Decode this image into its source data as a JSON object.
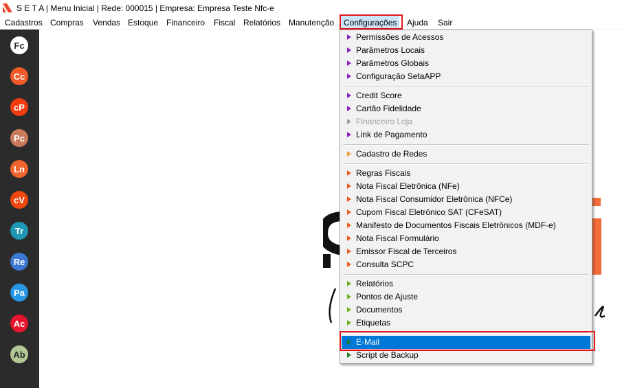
{
  "window": {
    "title": "S E T A | Menu Inicial | Rede: 000015 | Empresa: Empresa Teste Nfc-e"
  },
  "menubar": {
    "items": [
      {
        "label": "Cadastros"
      },
      {
        "label": "Compras"
      },
      {
        "label": "Vendas"
      },
      {
        "label": "Estoque"
      },
      {
        "label": "Financeiro"
      },
      {
        "label": "Fiscal"
      },
      {
        "label": "Relatórios"
      },
      {
        "label": "Manutenção"
      },
      {
        "label": "Configurações"
      },
      {
        "label": "Ajuda"
      },
      {
        "label": "Sair"
      }
    ],
    "active_index": 8
  },
  "sidebar": {
    "buttons": [
      {
        "label": "Fc",
        "color": "#ffffff",
        "text_color": "#2b2b2b"
      },
      {
        "label": "Cc",
        "color": "#f05a28"
      },
      {
        "label": "cP",
        "color": "#f03c0f"
      },
      {
        "label": "Pc",
        "color": "#c87a5a"
      },
      {
        "label": "Ln",
        "color": "#f0642d"
      },
      {
        "label": "cV",
        "color": "#f0460f"
      },
      {
        "label": "Tr",
        "color": "#1e96b4"
      },
      {
        "label": "Re",
        "color": "#3c78d2"
      },
      {
        "label": "Pa",
        "color": "#2896e6"
      },
      {
        "label": "Ac",
        "color": "#e6142d"
      },
      {
        "label": "Ab",
        "color": "#b4c896",
        "text_color": "#2b2b2b"
      }
    ]
  },
  "dropdown": {
    "groups": [
      {
        "arrow_color": "#8b21c4",
        "items": [
          {
            "label": "Permissões de Acessos"
          },
          {
            "label": "Parâmetros Locais"
          },
          {
            "label": "Parâmetros Globais"
          },
          {
            "label": "Configuração SetaAPP"
          }
        ]
      },
      {
        "arrow_color": "#8b21c4",
        "items": [
          {
            "label": "Credit Score"
          },
          {
            "label": "Cartão Fidelidade"
          },
          {
            "label": "Financeiro Loja",
            "disabled": true
          },
          {
            "label": "Link de Pagamento"
          }
        ]
      },
      {
        "arrow_color": "#f0a030",
        "items": [
          {
            "label": "Cadastro de Redes"
          }
        ]
      },
      {
        "arrow_color": "#f05a1e",
        "items": [
          {
            "label": "Regras Fiscais"
          },
          {
            "label": "Nota Fiscal Eletrônica (NFe)"
          },
          {
            "label": "Nota Fiscal Consumidor Eletrônica (NFCe)"
          },
          {
            "label": "Cupom Fiscal Eletrônico SAT (CFeSAT)"
          },
          {
            "label": "Manifesto de Documentos Fiscais Eletrônicos (MDF-e)"
          },
          {
            "label": "Nota Fiscal Formulário"
          },
          {
            "label": "Emissor Fiscal de Terceiros"
          },
          {
            "label": "Consulta SCPC"
          }
        ]
      },
      {
        "arrow_color": "#6cb41e",
        "items": [
          {
            "label": "Relatórios"
          },
          {
            "label": "Pontos de Ajuste"
          },
          {
            "label": "Documentos"
          },
          {
            "label": "Etiquetas"
          }
        ]
      },
      {
        "arrow_color": "#1e7a1e",
        "items": [
          {
            "label": "E-Mail",
            "selected": true
          },
          {
            "label": "Script de Backup"
          }
        ]
      }
    ]
  },
  "colors": {
    "highlight": "#e0161b",
    "selection": "#0078d7",
    "sidebar_bg": "#2b2b2b",
    "brand_orange": "#f26b3a"
  }
}
